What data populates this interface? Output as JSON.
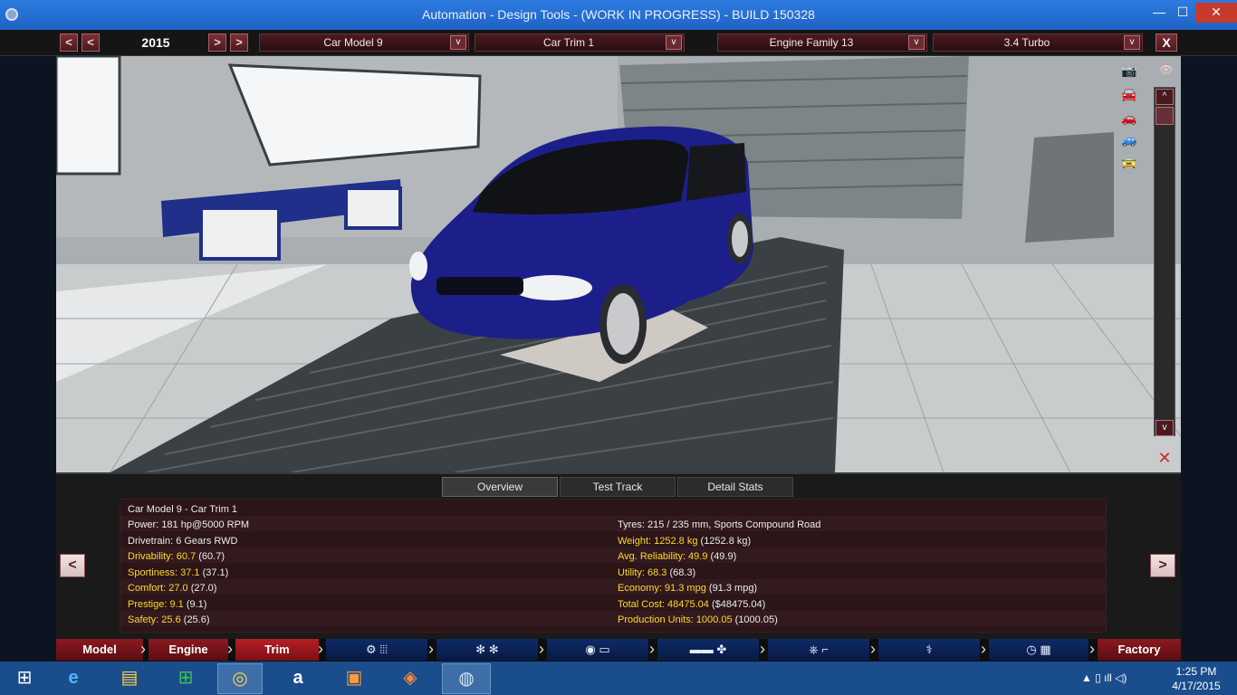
{
  "window": {
    "title": "Automation - Design Tools - (WORK IN PROGRESS) - BUILD 150328",
    "min_glyph": "—",
    "max_glyph": "☐",
    "close_glyph": "✕"
  },
  "toolbar": {
    "prev_prev": "<",
    "prev": "<",
    "year": "2015",
    "next": ">",
    "next_next": ">",
    "car_model": "Car Model 9",
    "car_trim": "Car Trim 1",
    "engine_family": "Engine Family 13",
    "engine_variant": "3.4 Turbo",
    "dropdown_arrow": "v",
    "close": "X"
  },
  "viewport": {
    "scroll_up": "^",
    "scroll_down": "v",
    "eye_glyph": "👁",
    "delete_glyph": "✕",
    "tool_icons": [
      "camera-icon",
      "car-front-icon",
      "car-side-icon",
      "car-rear-icon",
      "car-angle-icon"
    ]
  },
  "stats": {
    "tabs": [
      "Overview",
      "Test Track",
      "Detail Stats"
    ],
    "active_tab": "Overview",
    "header": "Car Model 9 - Car Trim 1",
    "left": [
      {
        "label": "Power:",
        "value": "181 hp@5000 RPM",
        "highlight": false
      },
      {
        "label": "Drivetrain:",
        "value": "6 Gears RWD",
        "highlight": false
      },
      {
        "label": "Drivability: 60.7",
        "value": "(60.7)",
        "highlight": true
      },
      {
        "label": "Sportiness: 37.1",
        "value": "(37.1)",
        "highlight": true
      },
      {
        "label": "Comfort: 27.0",
        "value": "(27.0)",
        "highlight": true
      },
      {
        "label": "Prestige: 9.1",
        "value": "(9.1)",
        "highlight": true
      },
      {
        "label": "Safety: 25.6",
        "value": "(25.6)",
        "highlight": true
      }
    ],
    "right": [
      {
        "label": "Tyres:",
        "value": "215 / 235 mm, Sports Compound Road",
        "highlight": false
      },
      {
        "label": "Weight: 1252.8 kg",
        "value": "(1252.8 kg)",
        "highlight": true
      },
      {
        "label": "Avg. Reliability: 49.9",
        "value": "(49.9)",
        "highlight": true
      },
      {
        "label": "Utility: 68.3",
        "value": "(68.3)",
        "highlight": true
      },
      {
        "label": "Economy: 91.3 mpg",
        "value": "(91.3 mpg)",
        "highlight": true
      },
      {
        "label": "Total Cost: 48475.04",
        "value": "($48475.04)",
        "highlight": true
      },
      {
        "label": "Production Units: 1000.05",
        "value": "(1000.05)",
        "highlight": true
      }
    ],
    "prev_arrow": "<",
    "next_arrow": ">"
  },
  "bottom_tabs": {
    "model": "Model",
    "engine": "Engine",
    "trim": "Trim",
    "factory": "Factory",
    "icon_tabs": [
      {
        "glyph": "⚙ ⦙⦙⦙",
        "icon": "gearbox-icon"
      },
      {
        "glyph": "✻ ✻",
        "icon": "wheels-icon"
      },
      {
        "glyph": "◉ ▭",
        "icon": "brakes-suspension-icon"
      },
      {
        "glyph": "▬▬ ✤",
        "icon": "body-aero-icon"
      },
      {
        "glyph": "⎈ ⌐",
        "icon": "interior-icon"
      },
      {
        "glyph": "⚕",
        "icon": "safety-icon"
      },
      {
        "glyph": "◷ ▦",
        "icon": "test-flag-icon"
      }
    ]
  },
  "taskbar": {
    "icons": [
      "windows-start-icon",
      "internet-explorer-icon",
      "file-explorer-icon",
      "store-icon",
      "chrome-icon",
      "amazon-icon",
      "app-icon-1",
      "app-icon-2",
      "automation-game-icon"
    ],
    "glyphs": [
      "⊞",
      "e",
      "▤",
      "⊞",
      "◎",
      "a",
      "▣",
      "◈",
      "◍"
    ],
    "tray_glyphs": "▲  ▯  ıll  ◁)",
    "time": "1:25 PM",
    "date": "4/17/2015"
  }
}
